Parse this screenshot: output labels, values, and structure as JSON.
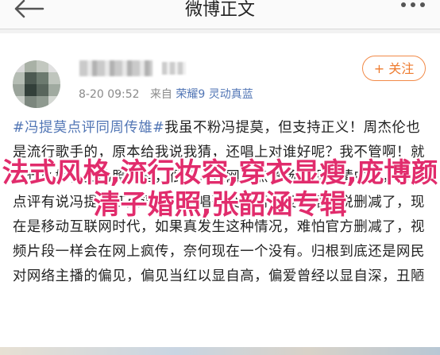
{
  "header": {
    "title": "微博正文",
    "back_icon": "arrow-left-icon",
    "more_icon": "more-dots-icon"
  },
  "post": {
    "time": "8-20 09:52",
    "source_prefix": "来自",
    "source": "荣耀9 灵动真蓝",
    "follow_label": "+ 关注",
    "tag": "#冯提莫点评同周传雄#",
    "content": "我虽不粉冯提莫，但支持正义！周杰伦也是流行歌手的，原本给我说我猜，还唱上对谁好呢？我不管啊！就有什么好，拍的照子里，很多人在网上点赞扬的观点猜中了，却被点评有说冯提莫红点评周传雄唱歌没感情，没证据就说删减了，现在是移动互联网时代，如果真发生这种情况，难怕官方删减了，视频片段一样会在网上疯传，奈何现在一个没有。归根到底还是网民对网络主播的偏见，偏见当红以显自高，偏爱曾经以显自深，丑陋"
  },
  "overlay": {
    "text": "法式风格,流行妆容,穿衣显瘦,庞博颜清子婚照,张韶涵专辑"
  },
  "colors": {
    "accent": "#ee7b2f",
    "link": "#5276b5",
    "overlay": "#e12c6c"
  }
}
